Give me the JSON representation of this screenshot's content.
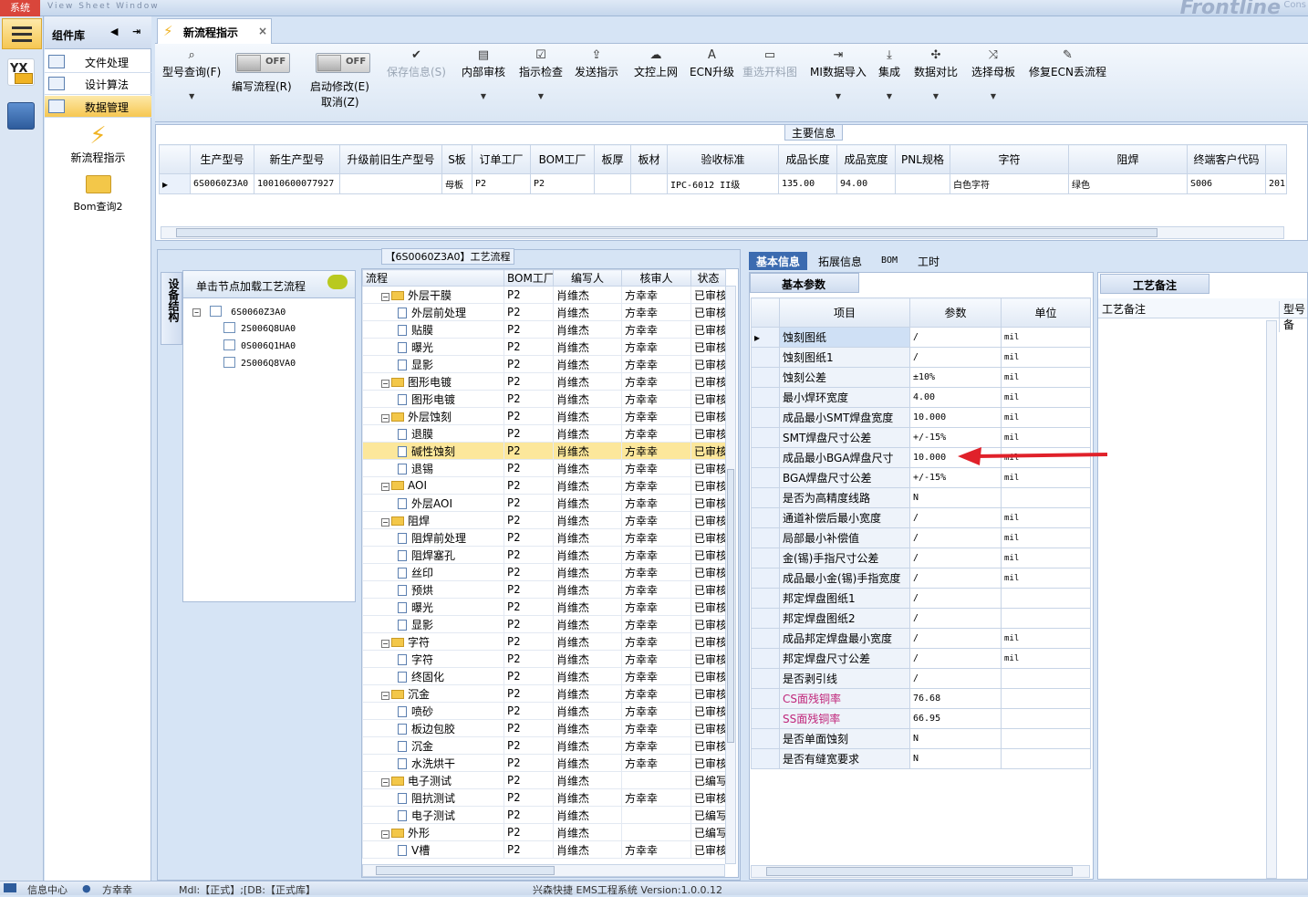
{
  "topbar": {
    "system_label": "系统",
    "menu_text": "View  Sheet  Window",
    "brand": "Frontline",
    "brand_right": "Cons"
  },
  "rail": {
    "icon1": "YX",
    "icon2": "menu-icon"
  },
  "library": {
    "title": "组件库",
    "items": [
      {
        "label": "文件处理"
      },
      {
        "label": "设计算法"
      },
      {
        "label": "数据管理"
      }
    ],
    "big_items": [
      {
        "label": "新流程指示"
      },
      {
        "label": "Bom查询2"
      }
    ]
  },
  "tab": {
    "label": "新流程指示"
  },
  "toolbar": {
    "buttons": [
      "型号查询(F)",
      "保存信息(S)",
      "内部审核",
      "指示检查",
      "发送指示",
      "文控上网",
      "ECN升级",
      "重选开料图",
      "MI数据导入",
      "集成",
      "数据对比",
      "选择母板",
      "修复ECN丢流程"
    ],
    "toggle1": {
      "state": "OFF",
      "label": "编写流程(R)"
    },
    "toggle2": {
      "state": "OFF",
      "label": "启动修改(E)",
      "label2": "取消(Z)"
    }
  },
  "main_info": {
    "title": "主要信息",
    "columns": [
      "生产型号",
      "新生产型号",
      "升级前旧生产型号",
      "S板",
      "订单工厂",
      "BOM工厂",
      "板厚",
      "板材",
      "验收标准",
      "成品长度",
      "成品宽度",
      "PNL规格",
      "字符",
      "阻焊",
      "终端客户代码",
      ""
    ],
    "row": [
      "6S0060Z3A0",
      "10010600077927",
      "",
      "母板",
      "P2",
      "P2",
      "",
      "",
      "IPC-6012 II级",
      "135.00",
      "94.00",
      "",
      "白色字符",
      "绿色",
      "S006",
      "201"
    ]
  },
  "process": {
    "title": "【6S0060Z3A0】工艺流程",
    "side_tab": "设备结构",
    "device_header": "单击节点加载工艺流程",
    "device_root": "6S0060Z3A0",
    "device_children": [
      "2S006Q8UA0",
      "0S006Q1HA0",
      "2S006Q8VA0"
    ],
    "columns": [
      "流程",
      "BOM工厂",
      "编写人",
      "核审人",
      "状态"
    ],
    "rows": [
      {
        "name": "外层干膜",
        "kind": "folder",
        "f": "P2",
        "w": "肖维杰",
        "r": "方幸幸",
        "s": "已审核"
      },
      {
        "name": "外层前处理",
        "kind": "leaf",
        "f": "P2",
        "w": "肖维杰",
        "r": "方幸幸",
        "s": "已审核"
      },
      {
        "name": "贴膜",
        "kind": "leaf",
        "f": "P2",
        "w": "肖维杰",
        "r": "方幸幸",
        "s": "已审核"
      },
      {
        "name": "曝光",
        "kind": "leaf",
        "f": "P2",
        "w": "肖维杰",
        "r": "方幸幸",
        "s": "已审核"
      },
      {
        "name": "显影",
        "kind": "leaf",
        "f": "P2",
        "w": "肖维杰",
        "r": "方幸幸",
        "s": "已审核"
      },
      {
        "name": "图形电镀",
        "kind": "folder",
        "f": "P2",
        "w": "肖维杰",
        "r": "方幸幸",
        "s": "已审核"
      },
      {
        "name": "图形电镀",
        "kind": "leaf",
        "f": "P2",
        "w": "肖维杰",
        "r": "方幸幸",
        "s": "已审核"
      },
      {
        "name": "外层蚀刻",
        "kind": "folder",
        "f": "P2",
        "w": "肖维杰",
        "r": "方幸幸",
        "s": "已审核"
      },
      {
        "name": "退膜",
        "kind": "leaf",
        "f": "P2",
        "w": "肖维杰",
        "r": "方幸幸",
        "s": "已审核"
      },
      {
        "name": "碱性蚀刻",
        "kind": "leaf",
        "f": "P2",
        "w": "肖维杰",
        "r": "方幸幸",
        "s": "已审核",
        "sel": true
      },
      {
        "name": "退锡",
        "kind": "leaf",
        "f": "P2",
        "w": "肖维杰",
        "r": "方幸幸",
        "s": "已审核"
      },
      {
        "name": "AOI",
        "kind": "folder",
        "f": "P2",
        "w": "肖维杰",
        "r": "方幸幸",
        "s": "已审核"
      },
      {
        "name": "外层AOI",
        "kind": "leaf",
        "f": "P2",
        "w": "肖维杰",
        "r": "方幸幸",
        "s": "已审核"
      },
      {
        "name": "阻焊",
        "kind": "folder",
        "f": "P2",
        "w": "肖维杰",
        "r": "方幸幸",
        "s": "已审核"
      },
      {
        "name": "阻焊前处理",
        "kind": "leaf",
        "f": "P2",
        "w": "肖维杰",
        "r": "方幸幸",
        "s": "已审核"
      },
      {
        "name": "阻焊塞孔",
        "kind": "leaf",
        "f": "P2",
        "w": "肖维杰",
        "r": "方幸幸",
        "s": "已审核"
      },
      {
        "name": "丝印",
        "kind": "leaf",
        "f": "P2",
        "w": "肖维杰",
        "r": "方幸幸",
        "s": "已审核"
      },
      {
        "name": "预烘",
        "kind": "leaf",
        "f": "P2",
        "w": "肖维杰",
        "r": "方幸幸",
        "s": "已审核"
      },
      {
        "name": "曝光",
        "kind": "leaf",
        "f": "P2",
        "w": "肖维杰",
        "r": "方幸幸",
        "s": "已审核"
      },
      {
        "name": "显影",
        "kind": "leaf",
        "f": "P2",
        "w": "肖维杰",
        "r": "方幸幸",
        "s": "已审核"
      },
      {
        "name": "字符",
        "kind": "folder",
        "f": "P2",
        "w": "肖维杰",
        "r": "方幸幸",
        "s": "已审核"
      },
      {
        "name": "字符",
        "kind": "leaf",
        "f": "P2",
        "w": "肖维杰",
        "r": "方幸幸",
        "s": "已审核"
      },
      {
        "name": "终固化",
        "kind": "leaf",
        "f": "P2",
        "w": "肖维杰",
        "r": "方幸幸",
        "s": "已审核"
      },
      {
        "name": "沉金",
        "kind": "folder",
        "f": "P2",
        "w": "肖维杰",
        "r": "方幸幸",
        "s": "已审核"
      },
      {
        "name": "喷砂",
        "kind": "leaf",
        "f": "P2",
        "w": "肖维杰",
        "r": "方幸幸",
        "s": "已审核"
      },
      {
        "name": "板边包胶",
        "kind": "leaf",
        "f": "P2",
        "w": "肖维杰",
        "r": "方幸幸",
        "s": "已审核"
      },
      {
        "name": "沉金",
        "kind": "leaf",
        "f": "P2",
        "w": "肖维杰",
        "r": "方幸幸",
        "s": "已审核"
      },
      {
        "name": "水洗烘干",
        "kind": "leaf",
        "f": "P2",
        "w": "肖维杰",
        "r": "方幸幸",
        "s": "已审核"
      },
      {
        "name": "电子测试",
        "kind": "folder",
        "f": "P2",
        "w": "肖维杰",
        "r": "",
        "s": "已编写"
      },
      {
        "name": "阻抗测试",
        "kind": "leaf",
        "f": "P2",
        "w": "肖维杰",
        "r": "方幸幸",
        "s": "已审核"
      },
      {
        "name": "电子测试",
        "kind": "leaf",
        "f": "P2",
        "w": "肖维杰",
        "r": "",
        "s": "已编写"
      },
      {
        "name": "外形",
        "kind": "folder",
        "f": "P2",
        "w": "肖维杰",
        "r": "",
        "s": "已编写"
      },
      {
        "name": "V槽",
        "kind": "leaf",
        "f": "P2",
        "w": "肖维杰",
        "r": "方幸幸",
        "s": "已审核"
      }
    ]
  },
  "right_tabs": [
    "基本信息",
    "拓展信息",
    "BOM",
    "工时"
  ],
  "basic": {
    "title": "基本参数",
    "columns": [
      "项目",
      "参数",
      "单位"
    ],
    "rows": [
      {
        "k": "蚀刻图纸",
        "v": "/",
        "u": "mil"
      },
      {
        "k": "蚀刻图纸1",
        "v": "/",
        "u": "mil"
      },
      {
        "k": "蚀刻公差",
        "v": "±10%",
        "u": "mil"
      },
      {
        "k": "最小焊环宽度",
        "v": "4.00",
        "u": "mil"
      },
      {
        "k": "成品最小SMT焊盘宽度",
        "v": "10.000",
        "u": "mil"
      },
      {
        "k": "SMT焊盘尺寸公差",
        "v": "+/-15%",
        "u": "mil"
      },
      {
        "k": "成品最小BGA焊盘尺寸",
        "v": "10.000",
        "u": "mil"
      },
      {
        "k": "BGA焊盘尺寸公差",
        "v": "+/-15%",
        "u": "mil"
      },
      {
        "k": "是否为高精度线路",
        "v": "N",
        "u": ""
      },
      {
        "k": "通道补偿后最小宽度",
        "v": "/",
        "u": "mil"
      },
      {
        "k": "局部最小补偿值",
        "v": "/",
        "u": "mil"
      },
      {
        "k": "金(锡)手指尺寸公差",
        "v": "/",
        "u": "mil"
      },
      {
        "k": "成品最小金(锡)手指宽度",
        "v": "/",
        "u": "mil"
      },
      {
        "k": "邦定焊盘图纸1",
        "v": "/",
        "u": ""
      },
      {
        "k": "邦定焊盘图纸2",
        "v": "/",
        "u": ""
      },
      {
        "k": "成品邦定焊盘最小宽度",
        "v": "/",
        "u": "mil"
      },
      {
        "k": "邦定焊盘尺寸公差",
        "v": "/",
        "u": "mil"
      },
      {
        "k": "是否剥引线",
        "v": "/",
        "u": ""
      },
      {
        "k": "CS面残铜率",
        "v": "76.68",
        "u": "",
        "hl": true
      },
      {
        "k": "SS面残铜率",
        "v": "66.95",
        "u": "",
        "hl": true
      },
      {
        "k": "是否单面蚀刻",
        "v": "N",
        "u": ""
      },
      {
        "k": "是否有缝宽要求",
        "v": "N",
        "u": ""
      }
    ]
  },
  "notes": {
    "title": "工艺备注",
    "col1": "工艺备注",
    "col2": "型号备"
  },
  "status": {
    "left": "信息中心",
    "user": "方幸幸",
    "mode": "Mdl:【正式】;[DB:【正式库】",
    "app": "兴森快捷 EMS工程系统 Version:1.0.0.12"
  },
  "colors": {
    "accent": "#3b6bb0",
    "selected_row": "#fce79b",
    "highlight_text": "#c0267a",
    "arrow": "#e0212a"
  }
}
